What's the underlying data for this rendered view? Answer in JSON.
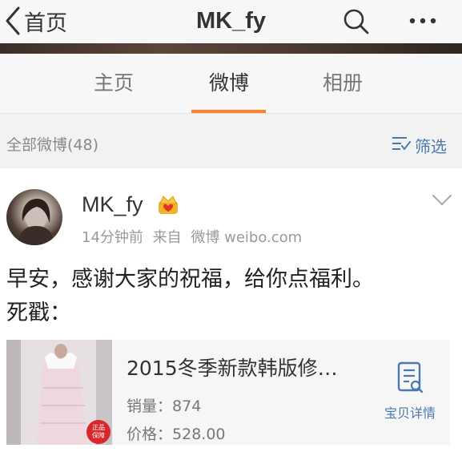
{
  "navbar": {
    "back_label": "首页",
    "title": "MK_fy",
    "icons": [
      "chevron-left-icon",
      "search-icon",
      "more-icon"
    ]
  },
  "tabs": [
    {
      "label": "主页",
      "active": false
    },
    {
      "label": "微博",
      "active": true
    },
    {
      "label": "相册",
      "active": false
    }
  ],
  "filterbar": {
    "count_label": "全部微博(48)",
    "filter_label": "筛选"
  },
  "post": {
    "username": "MK_fy",
    "time": "14分钟前",
    "source_prefix": "来自",
    "source": "微博 weibo.com",
    "text_line1": "早安，感谢大家的祝福，给你点福利。",
    "text_line2": "死戳："
  },
  "product": {
    "title": "2015冬季新款韩版修…",
    "sales_label": "销量：",
    "sales_value": "874",
    "price_label": "价格：",
    "price_value": "528.00",
    "detail_label": "宝贝详情",
    "badge_line1": "正品",
    "badge_line2": "保障"
  },
  "colors": {
    "accent": "#fd8225",
    "link": "#4a79b0"
  }
}
